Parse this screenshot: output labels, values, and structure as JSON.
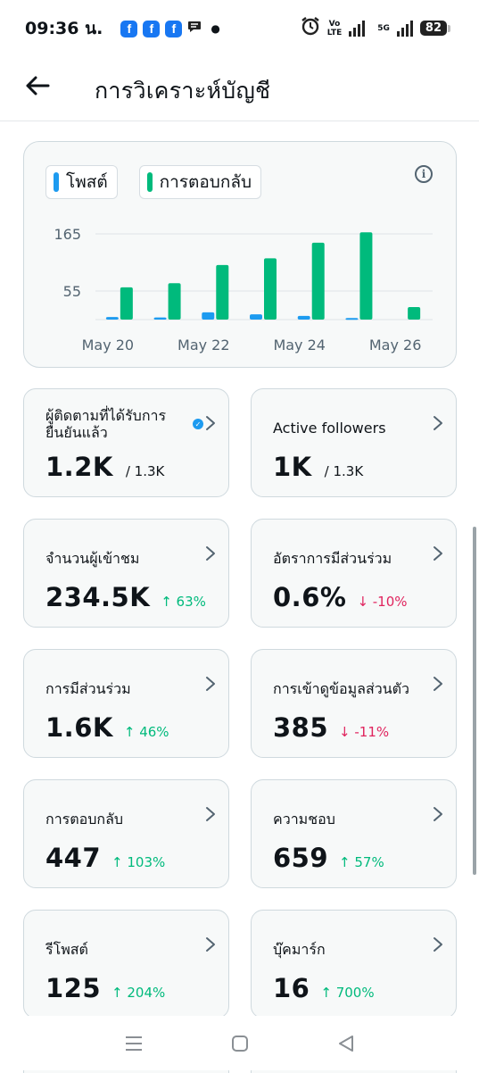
{
  "status_bar": {
    "time": "09:36 น.",
    "fb_letter": "f",
    "network_top": "Vo",
    "network_bottom": "LTE",
    "network_5g": "5G",
    "battery": "82"
  },
  "header": {
    "title": "การวิเคราะห์บัญชี"
  },
  "chart_legend": {
    "posts": "โพสต์",
    "replies": "การตอบกลับ",
    "info_glyph": "i"
  },
  "chart_data": {
    "type": "bar",
    "categories": [
      "May 20",
      "May 21",
      "May 22",
      "May 23",
      "May 24",
      "May 25",
      "May 26"
    ],
    "x_tick_labels": [
      "May 20",
      "May 22",
      "May 24",
      "May 26"
    ],
    "y_tick_labels": [
      "165",
      "55"
    ],
    "y_ticks": [
      165,
      55
    ],
    "ylim": [
      0,
      165
    ],
    "series": [
      {
        "name": "โพสต์",
        "color": "#1d9bf0",
        "values": [
          5,
          4,
          14,
          10,
          7,
          3,
          0
        ]
      },
      {
        "name": "การตอบกลับ",
        "color": "#00ba7c",
        "values": [
          62,
          70,
          105,
          118,
          148,
          168,
          24
        ]
      }
    ],
    "grid": true,
    "legend_position": "top-left"
  },
  "stats": [
    {
      "label": "ผู้ติดตามที่ได้รับการยืนยันแล้ว",
      "value": "1.2K",
      "sub": "/ 1.3K",
      "verified": true
    },
    {
      "label": "Active followers",
      "value": "1K",
      "sub": "/ 1.3K"
    },
    {
      "label": "จำนวนผู้เข้าชม",
      "value": "234.5K",
      "change": "↑ 63%",
      "direction": "up"
    },
    {
      "label": "อัตราการมีส่วนร่วม",
      "value": "0.6%",
      "change": "↓ -10%",
      "direction": "down"
    },
    {
      "label": "การมีส่วนร่วม",
      "value": "1.6K",
      "change": "↑ 46%",
      "direction": "up"
    },
    {
      "label": "การเข้าดูข้อมูลส่วนตัว",
      "value": "385",
      "change": "↓ -11%",
      "direction": "down"
    },
    {
      "label": "การตอบกลับ",
      "value": "447",
      "change": "↑ 103%",
      "direction": "up"
    },
    {
      "label": "ความชอบ",
      "value": "659",
      "change": "↑ 57%",
      "direction": "up"
    },
    {
      "label": "รีโพสต์",
      "value": "125",
      "change": "↑ 204%",
      "direction": "up"
    },
    {
      "label": "บุ๊คมาร์ก",
      "value": "16",
      "change": "↑ 700%",
      "direction": "up"
    }
  ],
  "colors": {
    "accent_blue": "#1d9bf0",
    "accent_green": "#00ba7c",
    "negative_red": "#e0245e",
    "card_bg": "#f7f9f9",
    "card_border": "#cfd9de"
  }
}
